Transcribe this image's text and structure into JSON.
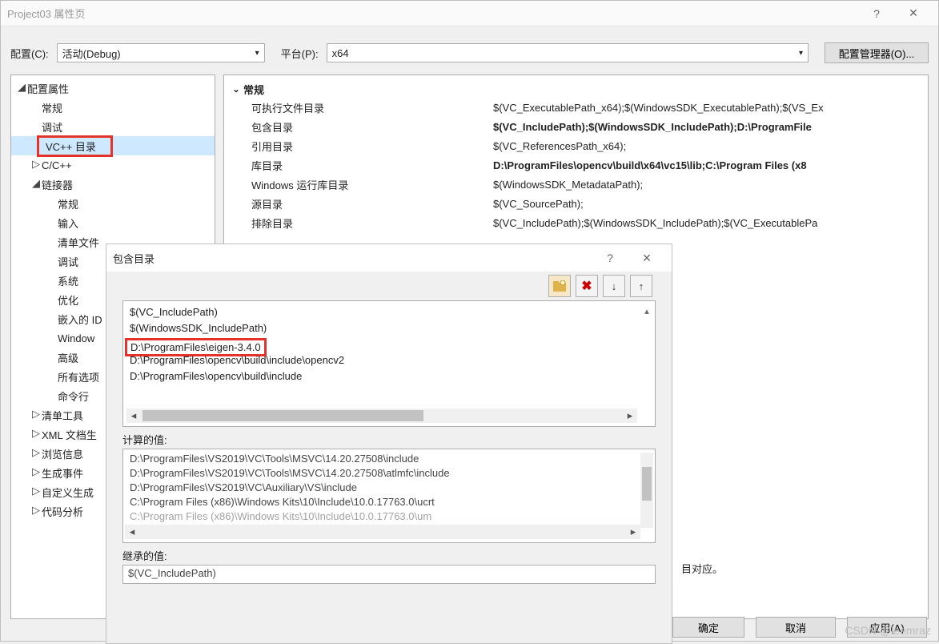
{
  "window": {
    "title": "Project03 属性页",
    "help_icon": "?",
    "close_icon": "✕"
  },
  "toprow": {
    "config_label": "配置(C):",
    "config_value": "活动(Debug)",
    "platform_label": "平台(P):",
    "platform_value": "x64",
    "manager_btn": "配置管理器(O)..."
  },
  "tree": {
    "root": "配置属性",
    "general": "常规",
    "debug": "调试",
    "vcpp_dirs": "VC++ 目录",
    "ccpp": "C/C++",
    "linker": "链接器",
    "linker_items": [
      "常规",
      "输入",
      "清单文件",
      "调试",
      "系统",
      "优化",
      "嵌入的 ID",
      "Window",
      "高级",
      "所有选项",
      "命令行"
    ],
    "manifest_tool": "清单工具",
    "xmldoc": "XML 文档生",
    "browseinfo": "浏览信息",
    "buildevents": "生成事件",
    "custombuild": "自定义生成",
    "codeanalysis": "代码分析"
  },
  "propgrid": {
    "group": "常规",
    "rows": [
      {
        "name": "可执行文件目录",
        "value": "$(VC_ExecutablePath_x64);$(WindowsSDK_ExecutablePath);$(VS_Ex",
        "bold": false
      },
      {
        "name": "包含目录",
        "value": "$(VC_IncludePath);$(WindowsSDK_IncludePath);D:\\ProgramFile",
        "bold": true
      },
      {
        "name": "引用目录",
        "value": "$(VC_ReferencesPath_x64);",
        "bold": false
      },
      {
        "name": "库目录",
        "value": "D:\\ProgramFiles\\opencv\\build\\x64\\vc15\\lib;C:\\Program Files (x8",
        "bold": true
      },
      {
        "name": "Windows 运行库目录",
        "value": "$(WindowsSDK_MetadataPath);",
        "bold": false
      },
      {
        "name": "源目录",
        "value": "$(VC_SourcePath);",
        "bold": false
      },
      {
        "name": "排除目录",
        "value": "$(VC_IncludePath);$(WindowsSDK_IncludePath);$(VC_ExecutablePa",
        "bold": false
      }
    ]
  },
  "dialog2": {
    "title": "包含目录",
    "help_icon": "?",
    "close_icon": "✕",
    "list": [
      "$(VC_IncludePath)",
      "$(WindowsSDK_IncludePath)",
      "D:\\ProgramFiles\\eigen-3.4.0",
      "D:\\ProgramFiles\\opencv\\build\\include\\opencv2",
      "D:\\ProgramFiles\\opencv\\build\\include"
    ],
    "highlight_index": 2,
    "computed_label": "计算的值:",
    "computed": [
      "D:\\ProgramFiles\\VS2019\\VC\\Tools\\MSVC\\14.20.27508\\include",
      "D:\\ProgramFiles\\VS2019\\VC\\Tools\\MSVC\\14.20.27508\\atlmfc\\include",
      "D:\\ProgramFiles\\VS2019\\VC\\Auxiliary\\VS\\include",
      "C:\\Program Files (x86)\\Windows Kits\\10\\Include\\10.0.17763.0\\ucrt",
      "C:\\Program Files (x86)\\Windows Kits\\10\\Include\\10.0.17763.0\\um"
    ],
    "inherited_label": "继承的值:",
    "inherited": "$(VC_IncludePath)"
  },
  "desc_note": "目对应。",
  "buttons": {
    "ok": "确定",
    "cancel": "取消",
    "apply": "应用(A)"
  },
  "watermark": "CSDN @leemraz"
}
